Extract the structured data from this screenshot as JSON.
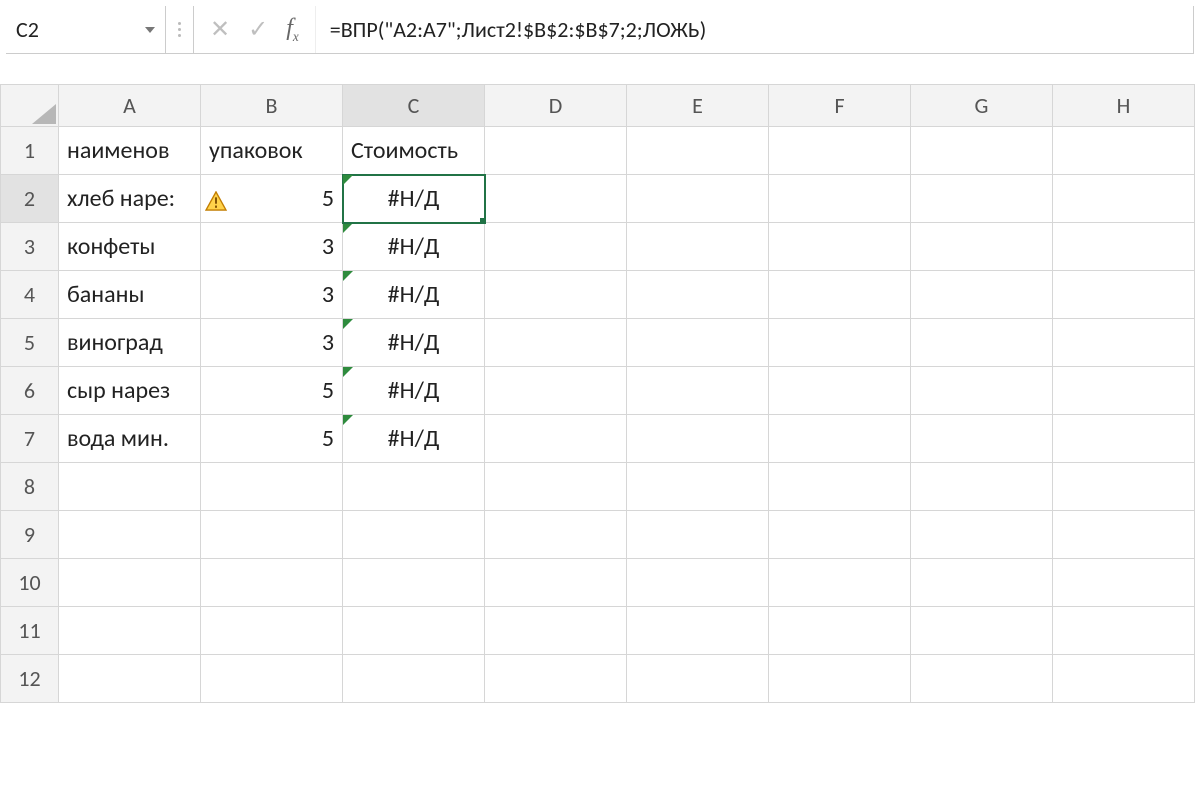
{
  "formula_bar": {
    "name_box": "C2",
    "cancel_glyph": "✕",
    "enter_glyph": "✓",
    "fx_label": "f",
    "fx_sub": "x",
    "formula": "=ВПР(\"A2:A7\";Лист2!$B$2:$B$7;2;ЛОЖЬ)"
  },
  "columns": [
    "A",
    "B",
    "C",
    "D",
    "E",
    "F",
    "G",
    "H"
  ],
  "row_numbers": [
    "1",
    "2",
    "3",
    "4",
    "5",
    "6",
    "7",
    "8",
    "9",
    "10",
    "11",
    "12"
  ],
  "selected": {
    "col": "C",
    "row": "2",
    "cell": "C2"
  },
  "cells": {
    "A1": "наименов",
    "B1": "упаковок",
    "C1": "Стоимость",
    "A2": "хлеб наре:",
    "B2": "5",
    "C2": "#Н/Д",
    "A3": "конфеты",
    "B3": "3",
    "C3": "#Н/Д",
    "A4": "бананы",
    "B4": "3",
    "C4": "#Н/Д",
    "A5": "виноград",
    "B5": "3",
    "C5": "#Н/Д",
    "A6": "сыр нарез",
    "B6": "5",
    "C6": "#Н/Д",
    "A7": "вода мин.",
    "B7": "5",
    "C7": "#Н/Д"
  },
  "icons": {
    "warning": "warning-triangle-icon"
  }
}
